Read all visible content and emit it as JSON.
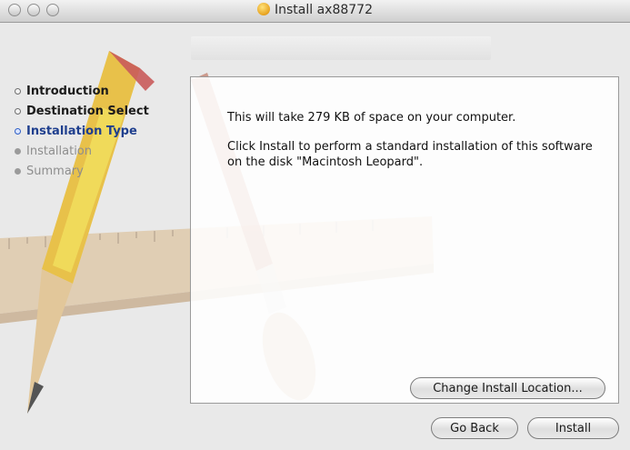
{
  "window": {
    "title": "Install ax88772"
  },
  "steps": [
    {
      "label": "Introduction",
      "state": "done"
    },
    {
      "label": "Destination Select",
      "state": "done"
    },
    {
      "label": "Installation Type",
      "state": "current"
    },
    {
      "label": "Installation",
      "state": "todo"
    },
    {
      "label": "Summary",
      "state": "todo"
    }
  ],
  "content": {
    "space_text": "This will take 279 KB of space on your computer.",
    "install_text": "Click Install to perform a standard installation of this software on the disk \"Macintosh Leopard\"."
  },
  "buttons": {
    "change_location": "Change Install Location...",
    "go_back": "Go Back",
    "install": "Install"
  },
  "colors": {
    "current_step": "#2f5fc6",
    "window_bg": "#e9e9e9"
  }
}
